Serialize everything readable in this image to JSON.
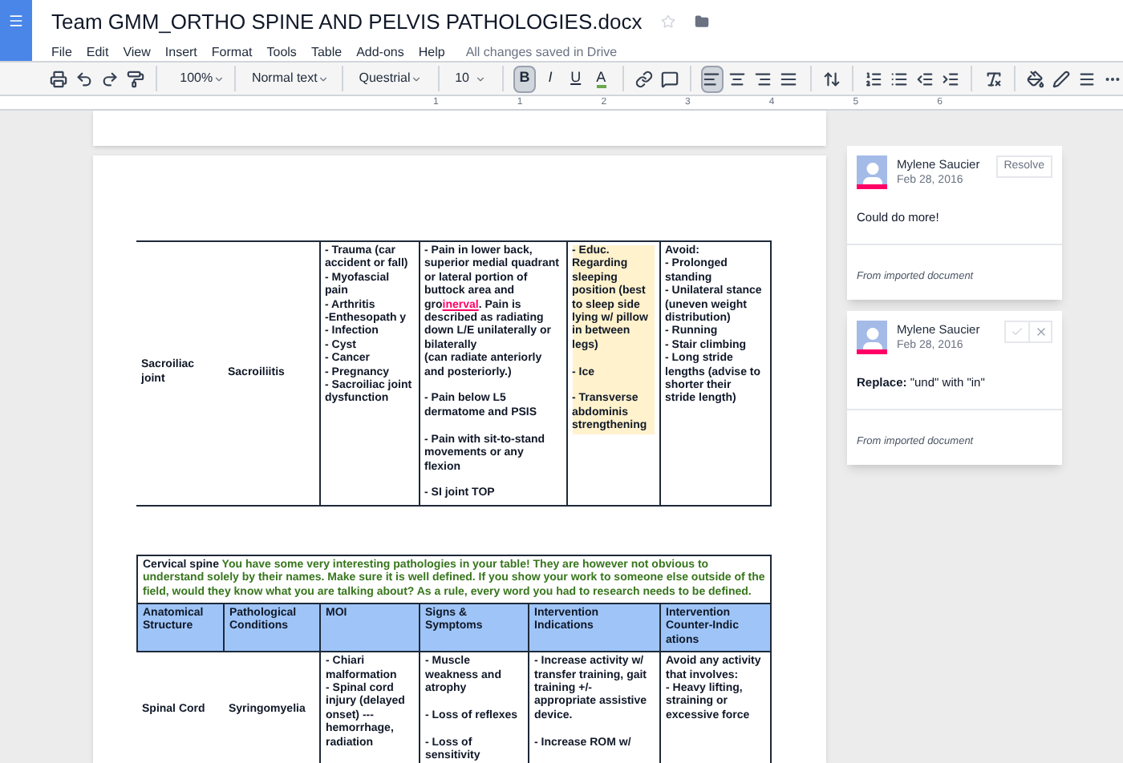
{
  "document": {
    "title": "Team GMM_ORTHO SPINE AND PELVIS PATHOLOGIES.docx",
    "save_status": "All changes saved in Drive"
  },
  "menu": [
    "File",
    "Edit",
    "View",
    "Insert",
    "Format",
    "Tools",
    "Table",
    "Add-ons",
    "Help"
  ],
  "toolbar": {
    "zoom": "100%",
    "style": "Normal text",
    "font": "Questrial",
    "size": "10",
    "format_buttons": [
      {
        "label": "B",
        "kind": "bold",
        "on": true
      },
      {
        "label": "I",
        "kind": "italic",
        "on": false
      },
      {
        "label": "U",
        "kind": "underline",
        "on": false
      },
      {
        "label": "A",
        "kind": "color",
        "on": false
      }
    ],
    "align_buttons": [
      {
        "kind": "left",
        "selected": true
      },
      {
        "kind": "center",
        "selected": false
      },
      {
        "kind": "right",
        "selected": false
      },
      {
        "kind": "justify",
        "selected": false
      }
    ]
  },
  "ruler": [
    "1",
    "1",
    "2",
    "3",
    "4",
    "5",
    "6"
  ],
  "table_1": {
    "rows": [
      [
        {
          "text": "Sacroiliac\njoint"
        },
        {
          "text": "Sacroiliitis"
        },
        {
          "text": "- Trauma (car accident or fall)\n- Myofascial pain\n- Arthritis\n-Enthesopath y\n- Infection\n- Cyst\n- Cancer\n- Pregnancy\n- Sacroiliac joint dysfunction"
        },
        {
          "parts": [
            {
              "text": "- Pain in lower back, superior medial quadrant or lateral portion of buttock area and gro",
              "suggestion": false
            },
            {
              "text": "inerval",
              "suggestion": true
            },
            {
              "text": ". Pain is described as radiating down L/E unilaterally or bilaterally\n(can radiate anteriorly and posteriorly.)\n\n- Pain below L5 dermatome and PSIS\n\n- Pain with sit-to-stand movements or any flexion\n\n- SI joint TOP",
              "suggestion": false
            }
          ]
        },
        {
          "text": "- Educ. Regarding sleeping position (best to sleep side lying w/ pillow in between legs)\n\n- Ice\n\n- Transverse abdominis strengthening",
          "highlighted": true
        },
        {
          "text": "Avoid:\n- Prolonged standing\n- Unilateral stance (uneven weight distribution)\n- Running\n- Stair climbing\n- Long stride lengths (advise to shorter their stride length)"
        }
      ]
    ]
  },
  "table_2": {
    "note_label": "Cervical spine",
    "note": "You have some very interesting pathologies in your table! They are however not obvious to understand solely by their names. Make sure it is well defined. If you show your work to someone else outside of the field, would they know what you are talking about? As a rule, every word you had to research needs to be defined.",
    "columns": [
      "Anatomical Structure",
      "Pathological Conditions",
      "MOI",
      "Signs & Symptoms",
      "Intervention Indications",
      "Intervention Counter-Indic ations"
    ],
    "rows": [
      [
        "Spinal Cord",
        "Syringomyelia",
        "- Chiari malformation\n- Spinal cord injury (delayed onset) --- hemorrhage, radiation",
        "- Muscle weakness and atrophy\n\n- Loss of reflexes\n\n- Loss of sensitivity",
        "- Increase activity w/ transfer training, gait training +/- appropriate assistive device.\n\n- Increase ROM w/",
        "Avoid any activity that involves:\n- Heavy lifting, straining or excessive force"
      ]
    ]
  },
  "comments": [
    {
      "author": "Mylene Saucier",
      "date": "Feb 28, 2016",
      "body": "Could do more!",
      "footer": "From imported document",
      "kind": "resolve",
      "action": "Resolve"
    },
    {
      "author": "Mylene Saucier",
      "date": "Feb 28, 2016",
      "body": "**Replace:** \"und\" with \"in\"",
      "footer": "From imported document",
      "kind": "suggestion"
    }
  ]
}
